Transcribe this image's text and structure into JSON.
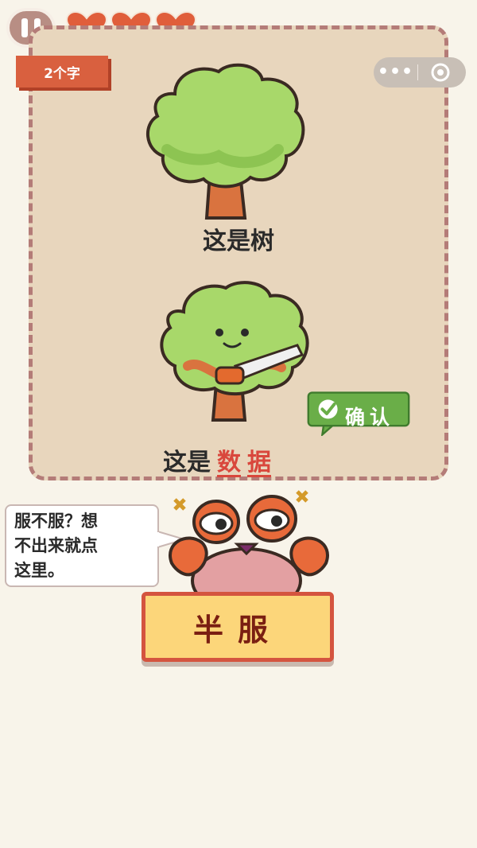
{
  "hud": {
    "hearts": 3,
    "badge_text": "2个字",
    "capsule_menu_icon": "more-dots-icon",
    "capsule_close_icon": "target-circle-icon"
  },
  "puzzle": {
    "caption_top": "这是树",
    "caption_bottom_prefix": "这是",
    "caption_bottom_word1": "数",
    "caption_bottom_word2": "据",
    "confirm_label": "确认"
  },
  "hint": {
    "bubble_text_lines": [
      "服不服？想",
      "不出来就点",
      "这里。"
    ],
    "button_label": "半服"
  },
  "colors": {
    "accent_red": "#d9603f",
    "confirm_green": "#6aae48",
    "card_bg": "#e8d6bd"
  }
}
